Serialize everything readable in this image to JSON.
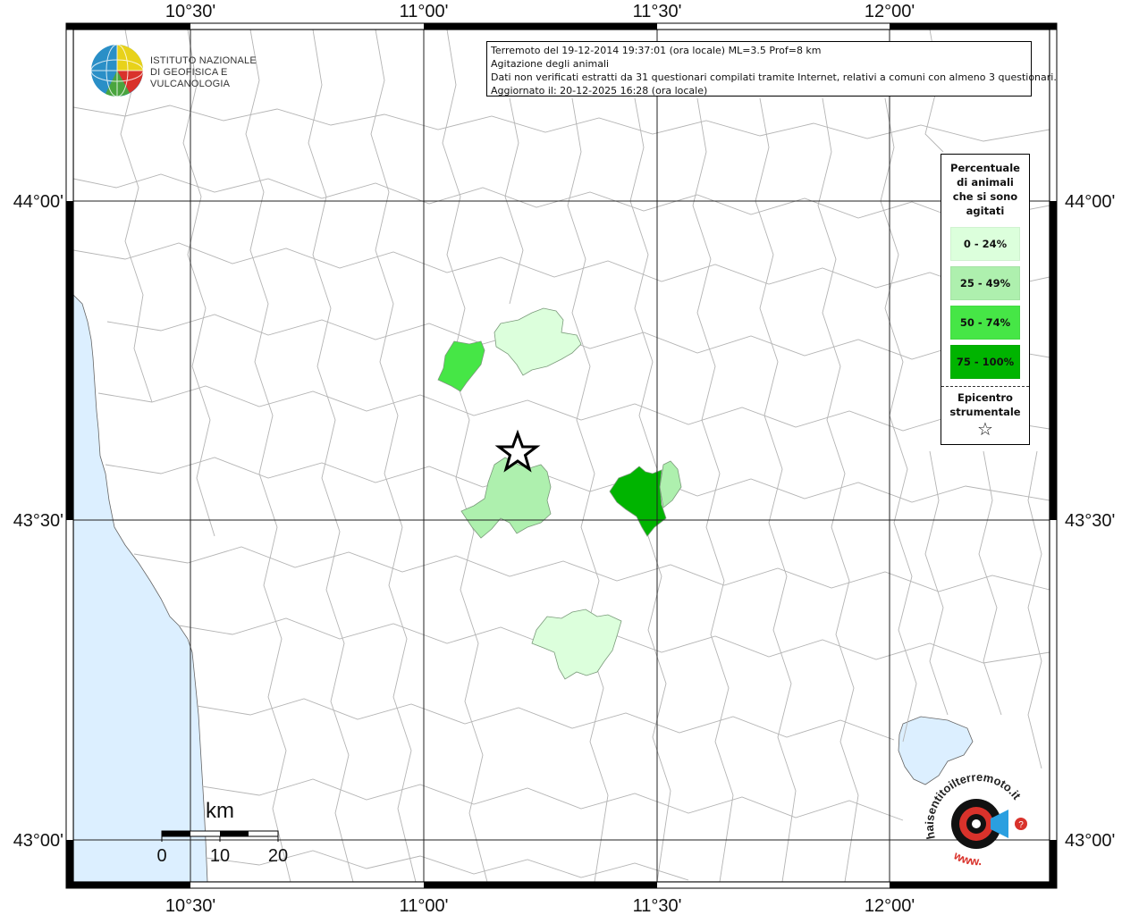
{
  "map": {
    "lon_labels": [
      "10°30'",
      "11°00'",
      "11°30'",
      "12°00'"
    ],
    "lat_labels": [
      "44°00'",
      "43°30'",
      "43°00'"
    ],
    "sea_color": "#dcefff",
    "land_color": "#ffffff",
    "border_color": "#b4b4b4"
  },
  "title_box": {
    "line1": "Terremoto del 19-12-2014 19:37:01 (ora locale) ML=3.5 Prof=8 km",
    "line2": "Agitazione degli animali",
    "line3": "Dati non verificati estratti da 31 questionari compilati tramite Internet, relativi a comuni con almeno 3 questionari.",
    "line4": "Aggiornato il: 20-12-2025 16:28 (ora locale)"
  },
  "legend": {
    "title_line1": "Percentuale",
    "title_line2": "di animali",
    "title_line3": "che si sono",
    "title_line4": "agitati",
    "classes": [
      {
        "label": "0 - 24%",
        "color": "#dcffdc"
      },
      {
        "label": "25 - 49%",
        "color": "#aef0ae"
      },
      {
        "label": "50 - 74%",
        "color": "#46e646"
      },
      {
        "label": "75 - 100%",
        "color": "#00b400"
      }
    ],
    "epicenter_line1": "Epicentro",
    "epicenter_line2": "strumentale",
    "epicenter_icon": "star-outline-icon"
  },
  "scale_bar": {
    "unit": "km",
    "ticks": [
      "0",
      "10",
      "20"
    ]
  },
  "logo_ingv": {
    "line1": "ISTITUTO NAZIONALE",
    "line2": "DI GEOFISICA E VULCANOLOGIA"
  },
  "logo_hst": {
    "top_text": "haisentitoilterremoto.it",
    "bottom_text": "www."
  }
}
